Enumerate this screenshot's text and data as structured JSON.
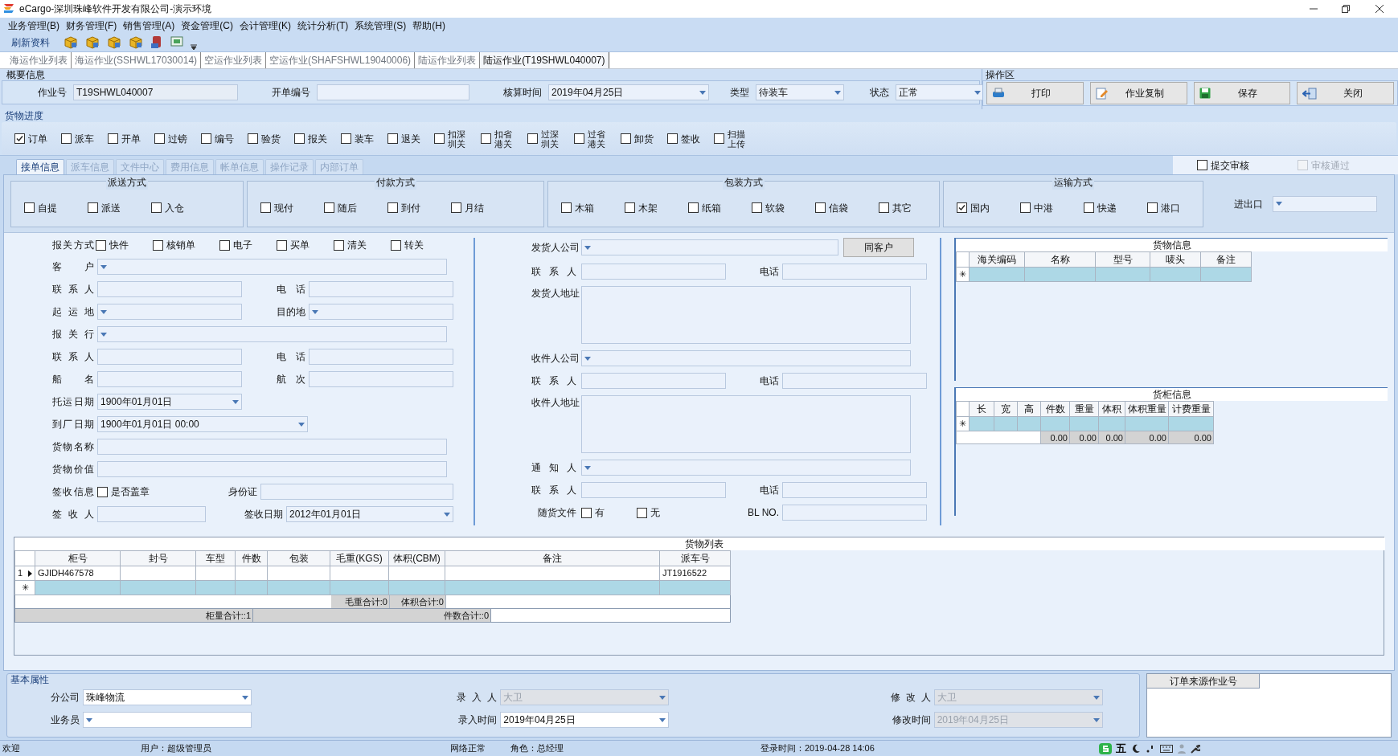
{
  "window": {
    "title": "eCargo-深圳珠峰软件开发有限公司-演示环境"
  },
  "menu": [
    "业务管理(B)",
    "财务管理(F)",
    "销售管理(A)",
    "资金管理(C)",
    "会计管理(K)",
    "统计分析(T)",
    "系统管理(S)",
    "帮助(H)"
  ],
  "toolbar": {
    "refresh_label": "刷新资料"
  },
  "doc_tabs": [
    {
      "label": "海运作业列表",
      "selected": false
    },
    {
      "label": "海运作业(SSHWL17030014)",
      "selected": false
    },
    {
      "label": "空运作业列表",
      "selected": false
    },
    {
      "label": "空运作业(SHAFSHWL19040006)",
      "selected": false
    },
    {
      "label": "陆运作业列表",
      "selected": false
    },
    {
      "label": "陆运作业(T19SHWL040007)",
      "selected": true
    }
  ],
  "overview": {
    "title": "概要信息",
    "fields": [
      {
        "label": "作业号",
        "kind": "readonly",
        "value": "T19SHWL040007"
      },
      {
        "label": "开单编号",
        "kind": "text"
      },
      {
        "label": "核算时间",
        "kind": "dropdown",
        "value": "2019年04月25日"
      },
      {
        "label": "类型",
        "kind": "dropdown",
        "value": "待装车"
      },
      {
        "label": "状态",
        "kind": "dropdown",
        "value": "正常"
      }
    ]
  },
  "operations": {
    "title": "操作区",
    "buttons": [
      {
        "label": "打印",
        "kind": "print"
      },
      {
        "label": "作业复制",
        "kind": "copy"
      },
      {
        "label": "保存",
        "kind": "save"
      },
      {
        "label": "关闭",
        "kind": "close"
      }
    ]
  },
  "progress": {
    "title": "货物进度",
    "items": [
      {
        "label": "订单",
        "checked": true
      },
      {
        "label": "派车",
        "checked": false
      },
      {
        "label": "开单",
        "checked": false
      },
      {
        "label": "过镑",
        "checked": false
      },
      {
        "label": "编号",
        "checked": false
      },
      {
        "label": "验货",
        "checked": false
      },
      {
        "label": "报关",
        "checked": false
      },
      {
        "label": "装车",
        "checked": false
      },
      {
        "label": "退关",
        "checked": false
      },
      {
        "label": "扣深圳关",
        "checked": false
      },
      {
        "label": "扣省港关",
        "checked": false
      },
      {
        "label": "过深圳关",
        "checked": false
      },
      {
        "label": "过省港关",
        "checked": false
      },
      {
        "label": "卸货",
        "checked": false
      },
      {
        "label": "签收",
        "checked": false
      },
      {
        "label": "扫描上传",
        "checked": false
      }
    ]
  },
  "form_tabs": [
    {
      "label": "接单信息",
      "selected": true
    },
    {
      "label": "派车信息",
      "selected": false
    },
    {
      "label": "文件中心",
      "selected": false
    },
    {
      "label": "费用信息",
      "selected": false
    },
    {
      "label": "帐单信息",
      "selected": false
    },
    {
      "label": "操作记录",
      "selected": false
    },
    {
      "label": "内部订单",
      "selected": false
    }
  ],
  "review": [
    {
      "label": "提交审核",
      "checked": false,
      "disabled": false
    },
    {
      "label": "审核通过",
      "checked": false,
      "disabled": true
    }
  ],
  "option_groups": [
    {
      "title": "派送方式",
      "options": [
        {
          "label": "自提",
          "checked": false
        },
        {
          "label": "派送",
          "checked": false
        },
        {
          "label": "入仓",
          "checked": false
        }
      ]
    },
    {
      "title": "付款方式",
      "options": [
        {
          "label": "现付",
          "checked": false
        },
        {
          "label": "随后",
          "checked": false
        },
        {
          "label": "到付",
          "checked": false
        },
        {
          "label": "月结",
          "checked": false
        }
      ]
    },
    {
      "title": "包装方式",
      "options": [
        {
          "label": "木箱",
          "checked": false
        },
        {
          "label": "木架",
          "checked": false
        },
        {
          "label": "纸箱",
          "checked": false
        },
        {
          "label": "软袋",
          "checked": false
        },
        {
          "label": "信袋",
          "checked": false
        },
        {
          "label": "其它",
          "checked": false
        }
      ]
    },
    {
      "title": "运输方式",
      "options": [
        {
          "label": "国内",
          "checked": true
        },
        {
          "label": "中港",
          "checked": false
        },
        {
          "label": "快递",
          "checked": false
        },
        {
          "label": "港口",
          "checked": false
        }
      ]
    }
  ],
  "import_export": {
    "label": "进出口"
  },
  "customs": {
    "label": "报关方式",
    "options": [
      {
        "label": "快件",
        "checked": false
      },
      {
        "label": "核销单",
        "checked": false
      },
      {
        "label": "电子",
        "checked": false
      },
      {
        "label": "买单",
        "checked": false
      },
      {
        "label": "清关",
        "checked": false
      },
      {
        "label": "转关",
        "checked": false
      }
    ]
  },
  "left_form": [
    [
      {
        "label": "客户",
        "kind": "dropdown"
      }
    ],
    [
      {
        "label": "联系人",
        "kind": "text"
      },
      {
        "label": "电话",
        "kind": "text"
      }
    ],
    [
      {
        "label": "起运地",
        "kind": "dropdown"
      },
      {
        "label": "目的地",
        "kind": "dropdown"
      }
    ],
    [
      {
        "label": "报关行",
        "kind": "dropdown"
      }
    ],
    [
      {
        "label": "联系人",
        "kind": "text"
      },
      {
        "label": "电话",
        "kind": "text"
      }
    ],
    [
      {
        "label": "船名",
        "kind": "text"
      },
      {
        "label": "航次",
        "kind": "text"
      }
    ],
    [
      {
        "label": "托运日期",
        "kind": "dropdown",
        "value": "1900年01月01日"
      }
    ],
    [
      {
        "label": "到厂日期",
        "kind": "dropdown",
        "value": "1900年01月01日 00:00"
      }
    ],
    [
      {
        "label": "货物名称",
        "kind": "text"
      }
    ],
    [
      {
        "label": "货物价值",
        "kind": "text"
      }
    ],
    [
      {
        "label": "签收信息",
        "kind": "checkbox",
        "option": "是否盖章",
        "checked": false
      },
      {
        "label": "身份证",
        "kind": "text"
      }
    ],
    [
      {
        "label": "签收人",
        "kind": "text"
      },
      {
        "label": "签收日期",
        "kind": "dropdown",
        "value": "2012年01月01日"
      }
    ]
  ],
  "middle_form": [
    {
      "label": "发货人公司",
      "kind": "dropdown",
      "button": "同客户"
    },
    {
      "label": "联系人",
      "kind": "text",
      "second": {
        "label": "电话"
      }
    },
    {
      "label": "发货人地址",
      "kind": "area"
    },
    {
      "label": "收件人公司",
      "kind": "dropdown"
    },
    {
      "label": "联系人",
      "kind": "text",
      "second": {
        "label": "电话"
      }
    },
    {
      "label": "收件人地址",
      "kind": "area"
    },
    {
      "label": "通知人",
      "kind": "dropdown"
    },
    {
      "label": "联系人",
      "kind": "text",
      "second": {
        "label": "电话"
      }
    },
    {
      "label": "随货文件",
      "kind": "checks",
      "options": [
        {
          "label": "有",
          "checked": false
        },
        {
          "label": "无",
          "checked": false
        }
      ],
      "second": {
        "label": "BL NO."
      }
    }
  ],
  "goods_info": {
    "title": "货物信息",
    "new_row_marker": "✳",
    "columns": [
      "海关编码",
      "名称",
      "型号",
      "唛头",
      "备注"
    ]
  },
  "container_info": {
    "title": "货柜信息",
    "new_row_marker": "✳",
    "columns": [
      "长",
      "宽",
      "高",
      "件数",
      "重量",
      "体积",
      "体积重量",
      "计费重量"
    ],
    "totals": [
      "0.00",
      "0.00",
      "0.00",
      "0.00",
      "0.00"
    ]
  },
  "goods_list": {
    "title": "货物列表",
    "columns": [
      "柜号",
      "封号",
      "车型",
      "件数",
      "包装",
      "毛重(KGS)",
      "体积(CBM)",
      "备注",
      "派车号"
    ],
    "rows": [
      {
        "number": "1",
        "current": true,
        "container_no": "GJIDH467578",
        "dispatch_no": "JT1916522"
      }
    ],
    "new_row_marker": "✳",
    "weight_total": "毛重合计:0",
    "volume_total": "体积合计:0",
    "container_total": "柜量合计::1",
    "pieces_total": "件数合计::0"
  },
  "basic": {
    "title": "基本属性",
    "fields": [
      {
        "label": "分公司",
        "value": "珠峰物流",
        "disabled": false
      },
      {
        "label": "录入人",
        "value": "大卫",
        "disabled": true
      },
      {
        "label": "修改人",
        "value": "大卫",
        "disabled": true
      },
      {
        "label": "业务员",
        "disabled": false
      },
      {
        "label": "录入时间",
        "value": "2019年04月25日",
        "disabled": false
      },
      {
        "label": "修改时间",
        "value": "2019年04月25日",
        "disabled": true
      }
    ]
  },
  "source": {
    "header": "订单来源作业号"
  },
  "status_bar": {
    "welcome": "欢迎",
    "user": "用户：超级管理员",
    "network": "网络正常",
    "role": "角色：总经理",
    "login": "登录时间：2019-04-28 14:06",
    "ime": "五"
  }
}
